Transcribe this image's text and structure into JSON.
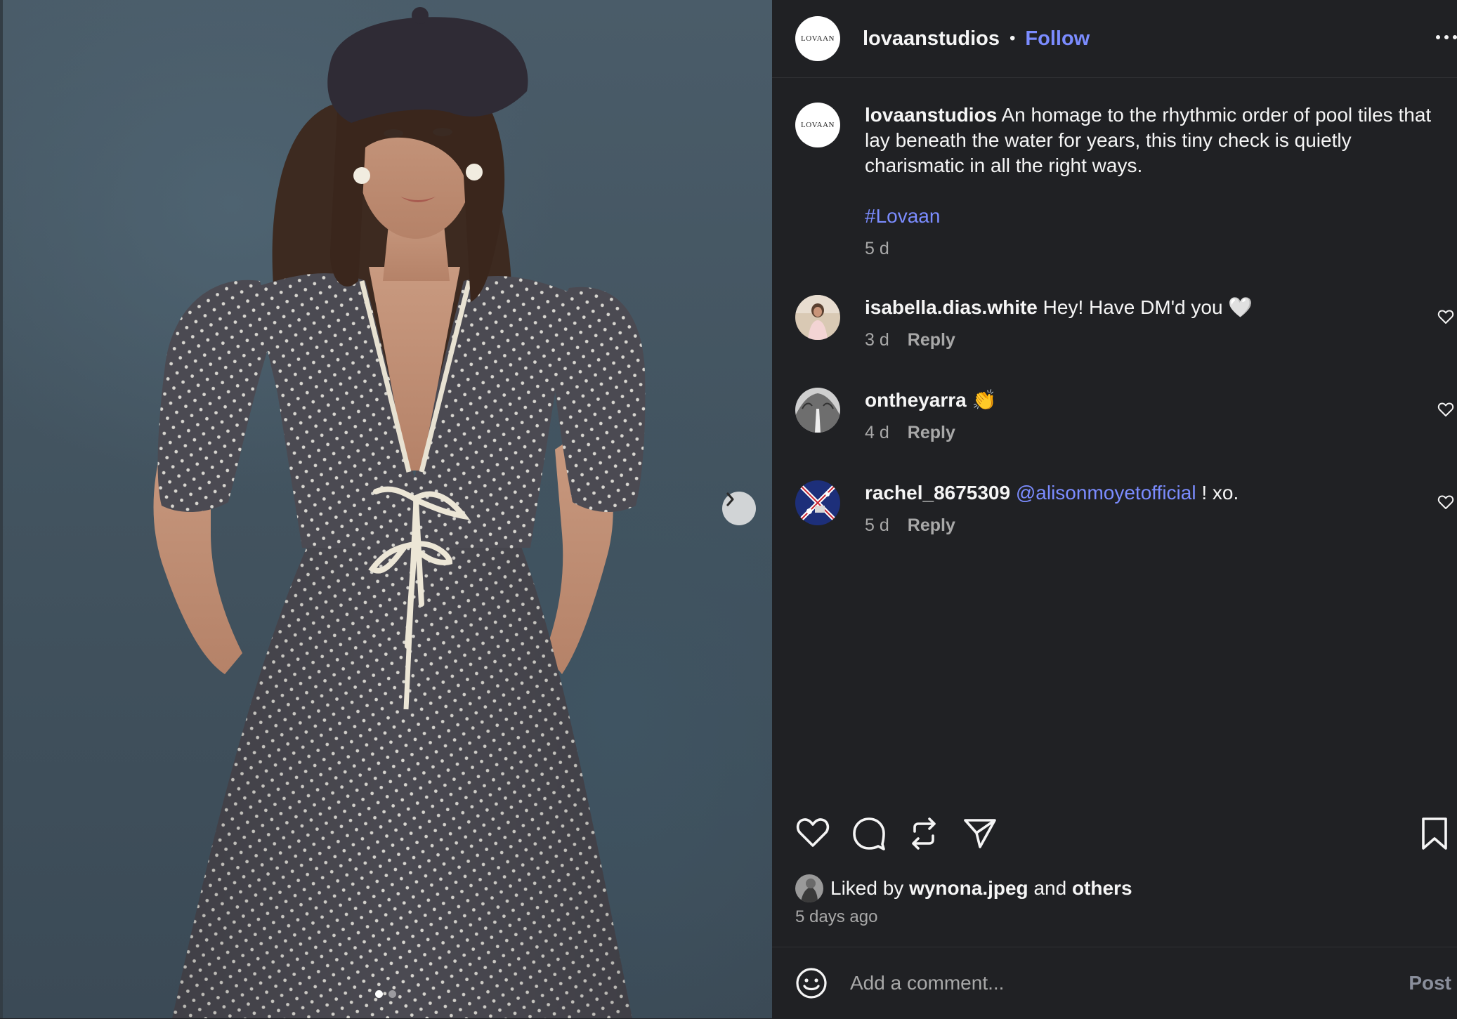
{
  "post": {
    "author": "lovaanstudios",
    "avatar_text": "LOVAAN",
    "follow_label": "Follow",
    "separator": "•",
    "image_alt": "Model wearing a puff-sleeve polka-dot midi dress with ribbon ties and a dark beret",
    "carousel": {
      "current": 1,
      "total": 2
    }
  },
  "caption": {
    "user": "lovaanstudios",
    "text": "An homage to the rhythmic order of pool tiles that lay beneath the water for years, this tiny check is quietly charismatic in all the right ways.",
    "hashtag": "#Lovaan",
    "age": "5 d"
  },
  "comments": [
    {
      "user": "isabella.dias.white",
      "text": "Hey! Have DM'd you 🤍",
      "age": "3 d",
      "reply_label": "Reply"
    },
    {
      "user": "ontheyarra",
      "text": "👏",
      "age": "4 d",
      "reply_label": "Reply"
    },
    {
      "user": "rachel_8675309",
      "mention": "@alisonmoyetofficial",
      "text": " ! xo.",
      "age": "5 d",
      "reply_label": "Reply"
    }
  ],
  "likes": {
    "prefix": "Liked by",
    "user": "wynona.jpeg",
    "conj": "and",
    "others": "others",
    "posted": "5 days ago"
  },
  "add_comment": {
    "placeholder": "Add a comment...",
    "post_label": "Post"
  },
  "colors": {
    "accent": "#7b8cff",
    "panel_bg": "#202124",
    "muted": "#a8a8a8"
  }
}
